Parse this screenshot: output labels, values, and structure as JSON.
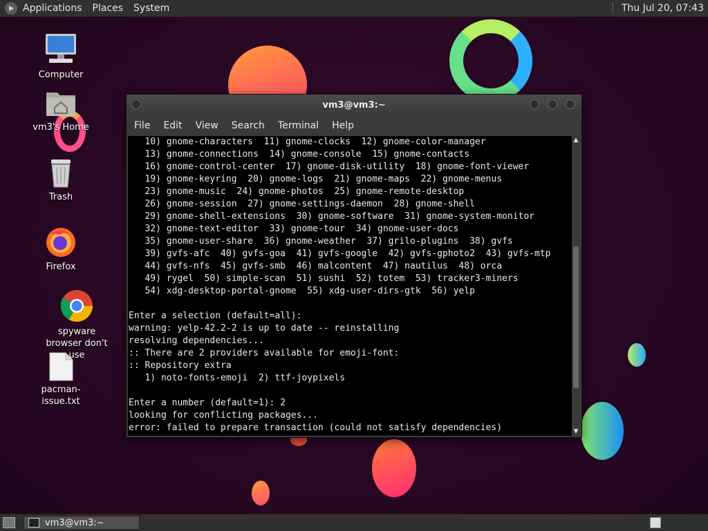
{
  "top_panel": {
    "menus": [
      "Applications",
      "Places",
      "System"
    ],
    "clock": "Thu Jul 20, 07:43"
  },
  "desktop_icons": [
    {
      "label": "Computer",
      "icon": "computer-icon"
    },
    {
      "label": "vm3's Home",
      "icon": "home-folder-icon"
    },
    {
      "label": "Trash",
      "icon": "trash-icon"
    },
    {
      "label": "Firefox",
      "icon": "firefox-icon"
    },
    {
      "label": "spyware browser don't use",
      "icon": "chrome-icon"
    },
    {
      "label": "pacman-issue.txt",
      "icon": "text-file-icon"
    }
  ],
  "terminal": {
    "title": "vm3@vm3:~",
    "menu": [
      "File",
      "Edit",
      "View",
      "Search",
      "Terminal",
      "Help"
    ],
    "lines": [
      "   10) gnome-characters  11) gnome-clocks  12) gnome-color-manager",
      "   13) gnome-connections  14) gnome-console  15) gnome-contacts",
      "   16) gnome-control-center  17) gnome-disk-utility  18) gnome-font-viewer",
      "   19) gnome-keyring  20) gnome-logs  21) gnome-maps  22) gnome-menus",
      "   23) gnome-music  24) gnome-photos  25) gnome-remote-desktop",
      "   26) gnome-session  27) gnome-settings-daemon  28) gnome-shell",
      "   29) gnome-shell-extensions  30) gnome-software  31) gnome-system-monitor",
      "   32) gnome-text-editor  33) gnome-tour  34) gnome-user-docs",
      "   35) gnome-user-share  36) gnome-weather  37) grilo-plugins  38) gvfs",
      "   39) gvfs-afc  40) gvfs-goa  41) gvfs-google  42) gvfs-gphoto2  43) gvfs-mtp",
      "   44) gvfs-nfs  45) gvfs-smb  46) malcontent  47) nautilus  48) orca",
      "   49) rygel  50) simple-scan  51) sushi  52) totem  53) tracker3-miners",
      "   54) xdg-desktop-portal-gnome  55) xdg-user-dirs-gtk  56) yelp",
      "",
      "Enter a selection (default=all):",
      "warning: yelp-42.2-2 is up to date -- reinstalling",
      "resolving dependencies...",
      ":: There are 2 providers available for emoji-font:",
      ":: Repository extra",
      "   1) noto-fonts-emoji  2) ttf-joypixels",
      "",
      "Enter a number (default=1): 2",
      "looking for conflicting packages...",
      "error: failed to prepare transaction (could not satisfy dependencies)"
    ]
  },
  "taskbar": {
    "window_label": "vm3@vm3:~"
  }
}
